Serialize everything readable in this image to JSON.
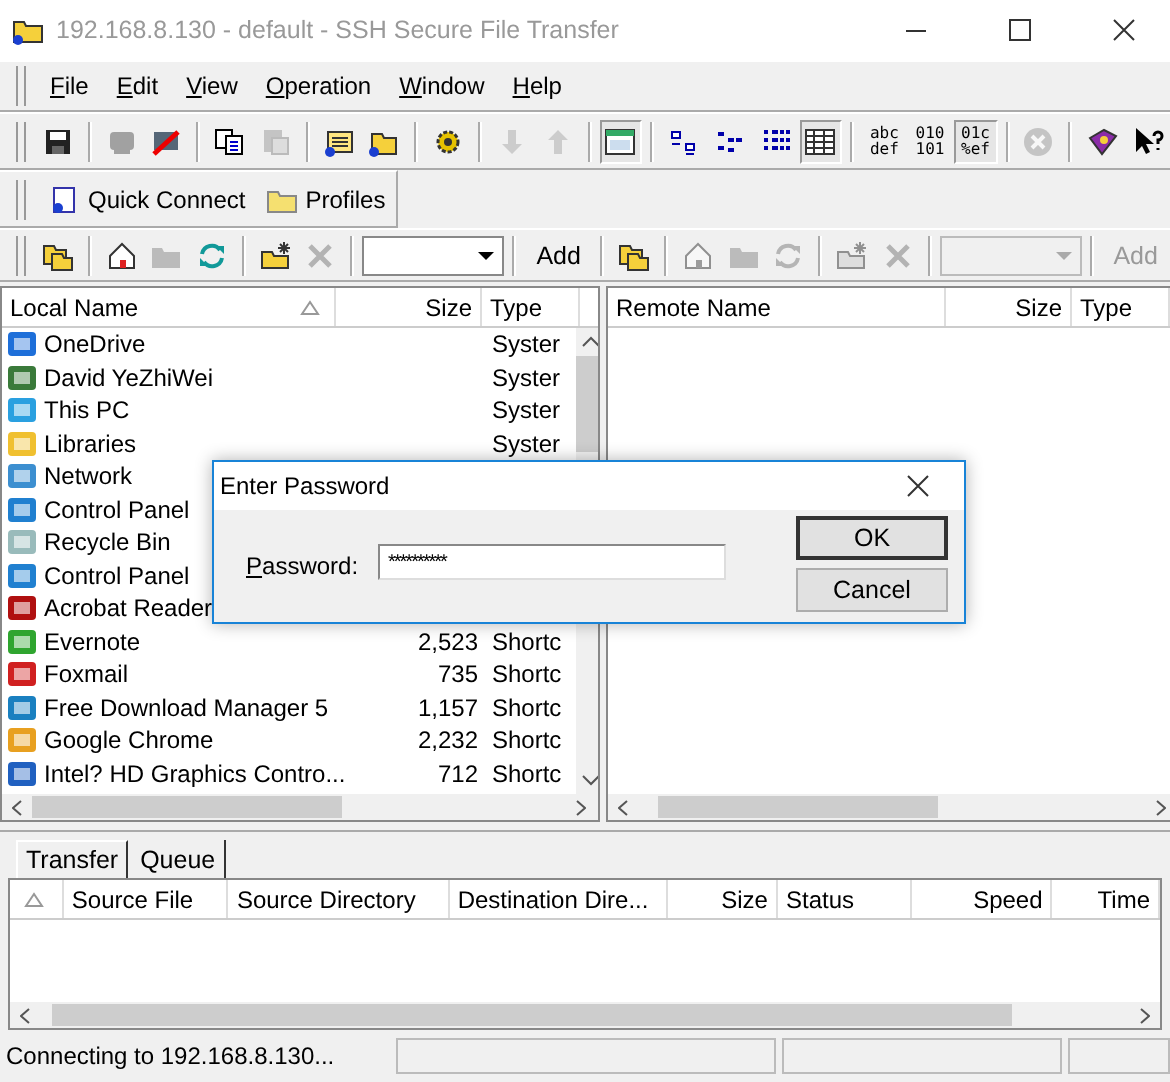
{
  "window": {
    "title": "192.168.8.130 - default - SSH Secure File Transfer"
  },
  "menu": [
    {
      "label": "File"
    },
    {
      "label": "Edit"
    },
    {
      "label": "View"
    },
    {
      "label": "Operation"
    },
    {
      "label": "Window"
    },
    {
      "label": "Help"
    }
  ],
  "toolbar": [
    [
      {
        "disabled": false,
        "selected": false
      }
    ],
    [
      {
        "disabled": true,
        "selected": false
      },
      {
        "disabled": false,
        "selected": false
      }
    ],
    [
      {
        "disabled": false,
        "selected": false
      },
      {
        "disabled": true,
        "selected": false
      }
    ],
    [
      {
        "disabled": false,
        "selected": false
      },
      {
        "disabled": false,
        "selected": false
      }
    ],
    [
      {
        "disabled": false,
        "selected": false
      }
    ],
    [
      {
        "disabled": true,
        "selected": false
      },
      {
        "disabled": true,
        "selected": false
      }
    ],
    [
      {
        "disabled": false,
        "selected": true
      }
    ],
    [
      {
        "disabled": false,
        "selected": false
      },
      {
        "disabled": false,
        "selected": false
      },
      {
        "disabled": false,
        "selected": false
      },
      {
        "disabled": false,
        "selected": true
      }
    ],
    [
      {
        "disabled": false,
        "selected": false,
        "lines": [
          "abc",
          "def"
        ]
      },
      {
        "disabled": false,
        "selected": false,
        "lines": [
          "010",
          "101"
        ]
      },
      {
        "disabled": false,
        "selected": true,
        "lines": [
          "01c",
          "%ef"
        ]
      }
    ],
    [
      {
        "disabled": true,
        "selected": false
      }
    ],
    [
      {
        "disabled": false,
        "selected": false
      },
      {
        "disabled": false,
        "selected": false
      }
    ]
  ],
  "quick_bar": [
    {
      "label": "Quick Connect"
    },
    {
      "label": "Profiles"
    }
  ],
  "local_bar": {
    "buttons": [
      [
        {
          "disabled": false
        }
      ],
      [
        {
          "disabled": false
        },
        {
          "disabled": true
        },
        {
          "disabled": false
        }
      ],
      [
        {
          "disabled": false
        },
        {
          "disabled": true
        }
      ]
    ],
    "add": {
      "label": "Add",
      "disabled": false
    }
  },
  "remote_bar": {
    "buttons": [
      [
        {
          "disabled": false
        }
      ],
      [
        {
          "disabled": true
        },
        {
          "disabled": true
        },
        {
          "disabled": true
        }
      ],
      [
        {
          "disabled": true
        },
        {
          "disabled": true
        }
      ]
    ],
    "add": {
      "label": "Add",
      "disabled": true
    }
  },
  "local_pane": {
    "columns": [
      "Local Name",
      "Size",
      "Type"
    ],
    "rows": [
      {
        "name": "OneDrive",
        "type": "Syster"
      },
      {
        "name": "David YeZhiWei",
        "type": "Syster"
      },
      {
        "name": "This PC",
        "type": "Syster"
      },
      {
        "name": "Libraries",
        "type": "Syster"
      },
      {
        "name": "Network"
      },
      {
        "name": "Control Panel"
      },
      {
        "name": "Recycle Bin"
      },
      {
        "name": "Control Panel"
      },
      {
        "name": "Acrobat Reader"
      },
      {
        "name": "Evernote",
        "size": "2,523",
        "type": "Shortc"
      },
      {
        "name": "Foxmail",
        "size": "735",
        "type": "Shortc"
      },
      {
        "name": "Free Download Manager 5",
        "size": "1,157",
        "type": "Shortc"
      },
      {
        "name": "Google Chrome",
        "size": "2,232",
        "type": "Shortc"
      },
      {
        "name": "Intel? HD Graphics Contro...",
        "size": "712",
        "type": "Shortc"
      }
    ]
  },
  "remote_pane": {
    "columns": [
      "Remote Name",
      "Size",
      "Type"
    ]
  },
  "dialog": {
    "title": "Enter Password",
    "label": "Password:",
    "value": "**********",
    "buttons": [
      "OK",
      "Cancel"
    ]
  },
  "transfer": {
    "tabs": [
      {
        "label": "Transfer",
        "selected": true
      },
      {
        "label": "Queue",
        "selected": false
      }
    ],
    "columns": [
      "Source File",
      "Source Directory",
      "Destination Dire...",
      "Size",
      "Status",
      "Speed",
      "Time"
    ]
  },
  "status_bar": {
    "text": "Connecting to 192.168.8.130..."
  }
}
